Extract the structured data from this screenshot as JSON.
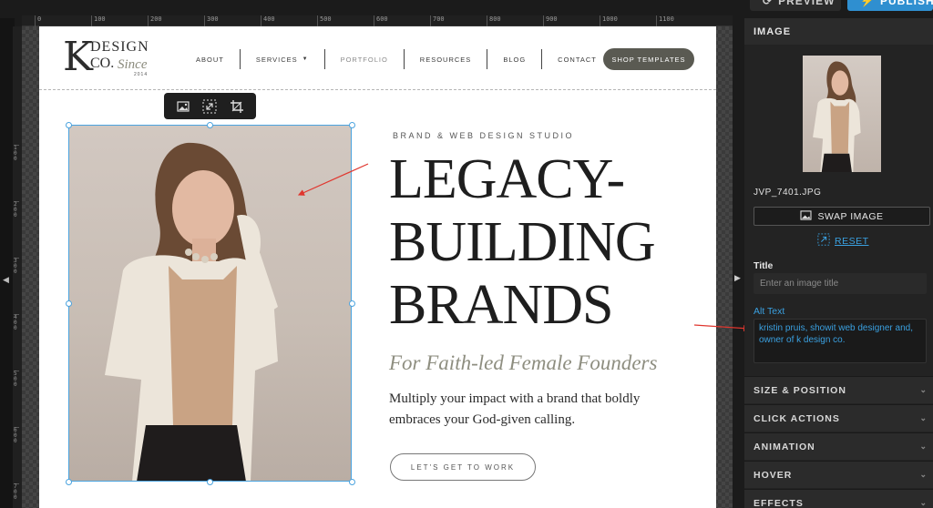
{
  "topbar": {
    "preview_label": "PREVIEW",
    "publish_label": "PUBLISH"
  },
  "ruler_h": [
    "0",
    "100",
    "200",
    "300",
    "400",
    "500",
    "600",
    "700",
    "800",
    "900",
    "1000",
    "1100"
  ],
  "ruler_v": [
    "100",
    "200",
    "300",
    "400",
    "500",
    "600",
    "700"
  ],
  "site": {
    "logo": {
      "k": "K",
      "design": "DESIGN",
      "co": "CO.",
      "since": "Since",
      "year": "2014"
    },
    "nav": [
      {
        "label": "ABOUT"
      },
      {
        "label": "SERVICES"
      },
      {
        "label": "PORTFOLIO"
      },
      {
        "label": "RESOURCES"
      },
      {
        "label": "BLOG"
      },
      {
        "label": "CONTACT"
      }
    ],
    "shop_label": "SHOP TEMPLATES",
    "eyebrow": "BRAND & WEB DESIGN STUDIO",
    "headline": [
      "LEGACY-",
      "BUILDING",
      "BRANDS"
    ],
    "subhead": "For Faith-led Female Founders",
    "body": "Multiply your impact with a brand that boldly embraces your God-given calling.",
    "cta_label": "LET'S GET TO WORK"
  },
  "panel": {
    "header": "IMAGE",
    "filename": "JVP_7401.JPG",
    "swap_label": "SWAP IMAGE",
    "reset_label": "RESET",
    "title_label": "Title",
    "title_value": "",
    "title_placeholder": "Enter an image title",
    "alt_label": "Alt Text",
    "alt_value": "kristin pruis, showit web designer and, owner of k design co.",
    "sections": [
      "SIZE & POSITION",
      "CLICK ACTIONS",
      "ANIMATION",
      "HOVER",
      "EFFECTS"
    ]
  },
  "colors": {
    "accent": "#3aa0e0",
    "publish": "#2f8fd0",
    "annotation": "#e0362e",
    "shop_button": "#5a5a52"
  }
}
